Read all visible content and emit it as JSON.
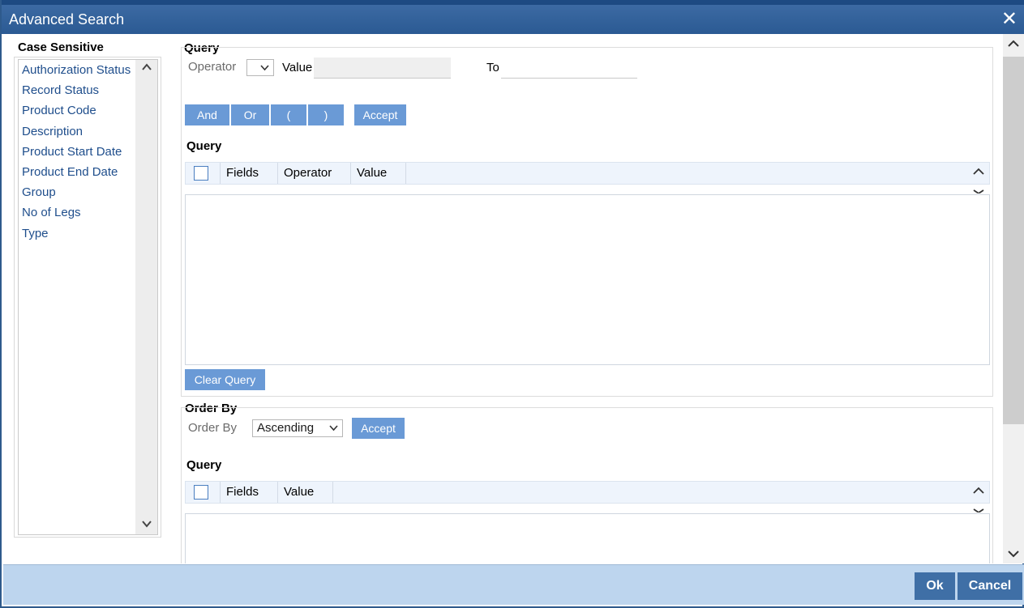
{
  "window": {
    "title": "Advanced Search",
    "close_glyph": "✕"
  },
  "left": {
    "header": "Case Sensitive",
    "fields": [
      "Authorization Status",
      "Record Status",
      "Product Code",
      "Description",
      "Product Start Date",
      "Product End Date",
      "Group",
      "No of Legs",
      "Type"
    ]
  },
  "query_section": {
    "title": "Query",
    "operator_label": "Operator",
    "value_label": "Value",
    "to_label": "To",
    "buttons": {
      "and": "And",
      "or": "Or",
      "open_paren": "(",
      "close_paren": ")",
      "accept": "Accept"
    },
    "grid_title": "Query",
    "grid_columns": [
      "Fields",
      "Operator",
      "Value"
    ],
    "clear_query": "Clear Query"
  },
  "order_section": {
    "title": "Order By",
    "order_by_label": "Order By",
    "order_value": "Ascending",
    "accept": "Accept",
    "grid_title": "Query",
    "grid_columns": [
      "Fields",
      "Value"
    ]
  },
  "footer": {
    "ok": "Ok",
    "cancel": "Cancel"
  },
  "icons": {
    "scroll_up": "chevron-up-icon",
    "scroll_down": "chevron-down-icon",
    "dropdown": "chevron-down-icon",
    "close": "close-icon"
  },
  "colors": {
    "titlebar": "#2b5a93",
    "button": "#6a9ad6",
    "footer": "#bdd5ee",
    "footer_button": "#3f6fa6",
    "link": "#1f4e8c"
  }
}
